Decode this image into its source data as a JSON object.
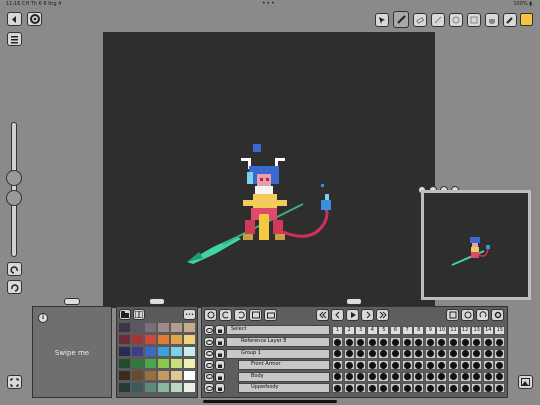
{
  "status_bar": {
    "time": "11:16 CH",
    "date": "Th 6 8 thg 4",
    "battery": "100%",
    "dots": "•••"
  },
  "reference_panel": {
    "label": "Swipe me",
    "info_glyph": "i"
  },
  "palette": {
    "colors": [
      "#3a3644",
      "#5b5566",
      "#7b6e7e",
      "#9e8a8a",
      "#b49c91",
      "#c8a98e",
      "#6b2b3a",
      "#a3343a",
      "#cc4a3c",
      "#e07a3a",
      "#e2a64a",
      "#f0d27a",
      "#2a2a55",
      "#3d3d88",
      "#3d6ac0",
      "#3ea0d8",
      "#7ed0e8",
      "#c8ecf0",
      "#1f4d2f",
      "#2e7a3a",
      "#4aa64a",
      "#88c84a",
      "#c8e07a",
      "#f0f0b0",
      "#3b2a1e",
      "#6b4a2a",
      "#98703f",
      "#c49a5e",
      "#e0c890",
      "#ffffff",
      "#2a3a3a",
      "#3f5a5a",
      "#5c8a7a",
      "#8ab89a",
      "#b8d8c0",
      "#e8f0e8"
    ],
    "more_glyph": "•••"
  },
  "timeline": {
    "select_label": "Select",
    "frame_numbers": [
      "1",
      "2",
      "3",
      "4",
      "5",
      "6",
      "7",
      "8",
      "9",
      "10",
      "11",
      "12",
      "13",
      "14",
      "15"
    ],
    "layers": [
      {
        "name": "Reference Layer 8",
        "indent": 0
      },
      {
        "name": "Group 1",
        "indent": 0
      },
      {
        "name": "Front Armor",
        "indent": 1
      },
      {
        "name": "Body",
        "indent": 1
      },
      {
        "name": "Upperbody",
        "indent": 1
      }
    ]
  },
  "colors": {
    "primary_color": "#f5c542",
    "canvas_bg": "#2e2e2e",
    "app_bg": "#8a8a8a"
  }
}
